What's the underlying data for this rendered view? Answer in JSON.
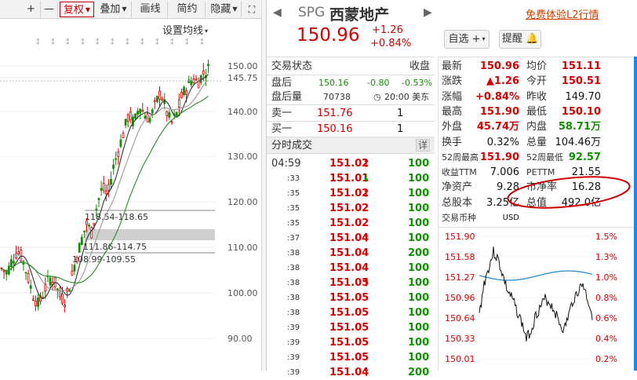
{
  "toolbar": {
    "items": [
      "+",
      "—",
      "复权",
      "叠加",
      "画线",
      "简约",
      "隐藏"
    ],
    "expand_icon": "expand-icon"
  },
  "kline": {
    "settings_label": "设置均线",
    "price_labels": [
      "150.00",
      "145.75",
      "140.00",
      "130.00",
      "120.00",
      "110.00",
      "100.00",
      "90.00"
    ],
    "box_labels": [
      "118.54-118.65",
      "111.86-114.75",
      "108.99-109.55"
    ]
  },
  "header": {
    "ticker": "SPG",
    "name": "西蒙地产",
    "price": "150.96",
    "change": "+1.26",
    "change_pct": "+0.84%",
    "promo_link": "免费体验L2行情",
    "watch_button": "自选",
    "alert_button": "提醒"
  },
  "status": {
    "title": "交易状态",
    "status_value": "收盘",
    "rows": [
      {
        "label": "盘后",
        "price": "150.16",
        "chg": "-0.80",
        "pct": "-0.53%"
      },
      {
        "label": "盘后量",
        "vol": "70738",
        "time": "20:00 美东"
      }
    ],
    "book": [
      {
        "label": "卖一",
        "price": "151.76",
        "qty": "1"
      },
      {
        "label": "买一",
        "price": "150.16",
        "qty": "1"
      }
    ]
  },
  "trades": {
    "title": "分时成交",
    "detail_button": "详",
    "rows": [
      {
        "time": "04:59",
        "price": "151.02",
        "dir": "up",
        "vol": "100"
      },
      {
        "time": ":33",
        "price": "151.01",
        "dir": "down",
        "vol": "100"
      },
      {
        "time": ":35",
        "price": "151.02",
        "dir": "up",
        "vol": "100"
      },
      {
        "time": ":35",
        "price": "151.02",
        "dir": "",
        "vol": "100"
      },
      {
        "time": ":35",
        "price": "151.02",
        "dir": "",
        "vol": "100"
      },
      {
        "time": ":37",
        "price": "151.04",
        "dir": "up",
        "vol": "100"
      },
      {
        "time": ":38",
        "price": "151.04",
        "dir": "",
        "vol": "200"
      },
      {
        "time": ":38",
        "price": "151.04",
        "dir": "",
        "vol": "100"
      },
      {
        "time": ":38",
        "price": "151.05",
        "dir": "up",
        "vol": "100"
      },
      {
        "time": ":38",
        "price": "151.05",
        "dir": "",
        "vol": "100"
      },
      {
        "time": ":38",
        "price": "151.05",
        "dir": "",
        "vol": "100"
      },
      {
        "time": ":39",
        "price": "151.05",
        "dir": "",
        "vol": "100"
      },
      {
        "time": ":39",
        "price": "151.05",
        "dir": "",
        "vol": "100"
      },
      {
        "time": ":39",
        "price": "151.05",
        "dir": "",
        "vol": "100"
      },
      {
        "time": ":39",
        "price": "151.04",
        "dir": "up",
        "vol": "200"
      }
    ]
  },
  "quote": {
    "rows": [
      [
        {
          "label": "最新",
          "value": "150.96",
          "color": "red"
        },
        {
          "label": "均价",
          "value": "151.11",
          "color": "red"
        }
      ],
      [
        {
          "label": "涨跌",
          "value": "▲1.26",
          "color": "red"
        },
        {
          "label": "今开",
          "value": "150.51",
          "color": "red"
        }
      ],
      [
        {
          "label": "涨幅",
          "value": "+0.84%",
          "color": "red"
        },
        {
          "label": "昨收",
          "value": "149.70",
          "color": "blk"
        }
      ],
      [
        {
          "label": "最高",
          "value": "151.90",
          "color": "red"
        },
        {
          "label": "最低",
          "value": "150.10",
          "color": "red"
        }
      ],
      [
        {
          "label": "外盘",
          "value": "45.74万",
          "color": "red"
        },
        {
          "label": "内盘",
          "value": "58.71万",
          "color": "grn"
        }
      ],
      [
        {
          "label": "换手",
          "value": "0.32%",
          "color": "blk"
        },
        {
          "label": "总量",
          "value": "104.46万",
          "color": "blk"
        }
      ],
      [
        {
          "label": "52周最高",
          "value": "151.90",
          "color": "red"
        },
        {
          "label": "52周最低",
          "value": "92.57",
          "color": "grn"
        }
      ],
      [
        {
          "label": "收益TTM",
          "value": "7.006",
          "color": "blk"
        },
        {
          "label": "PETTM",
          "value": "21.55",
          "color": "blk"
        }
      ],
      [
        {
          "label": "净资产",
          "value": "9.28",
          "color": "blk"
        },
        {
          "label": "市净率",
          "value": "16.28",
          "color": "blk"
        }
      ],
      [
        {
          "label": "总股本",
          "value": "3.25亿",
          "color": "blk"
        },
        {
          "label": "总值",
          "value": "492.0亿",
          "color": "blk"
        }
      ],
      [
        {
          "label": "交易币种",
          "value": "USD",
          "color": "blk"
        },
        {
          "label": "",
          "value": "",
          "color": "blk"
        }
      ]
    ]
  },
  "minichart": {
    "price_labels": [
      "151.90",
      "151.58",
      "151.27",
      "150.96",
      "150.64",
      "150.33",
      "150.01"
    ],
    "pct_labels": [
      "1.5%",
      "1.3%",
      "1.0%",
      "0.8%",
      "0.6%",
      "0.4%",
      "0.2%"
    ]
  },
  "colors": {
    "up": "#d40000",
    "down": "#109000",
    "annotation": "#d00000"
  }
}
